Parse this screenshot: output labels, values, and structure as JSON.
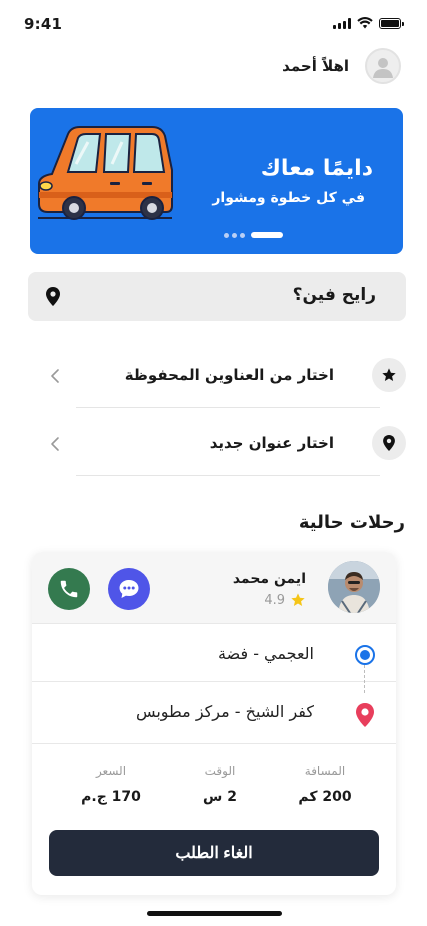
{
  "status_bar": {
    "time": "9:41"
  },
  "header": {
    "greeting": "اهلاً أحمد",
    "avatar_icon": "user-icon"
  },
  "banner": {
    "title": "دايمًا معاك",
    "subtitle": "في كل خطوة ومشوار",
    "background_color": "#1a73e8",
    "carousel": {
      "dot_count": 4,
      "active_index": 3
    }
  },
  "search": {
    "placeholder": "رايح فين؟",
    "icon": "location-pin-icon"
  },
  "address_options": [
    {
      "label": "اختار من العناوين المحفوظة",
      "icon": "star-icon"
    },
    {
      "label": "اختار عنوان جديد",
      "icon": "location-pin-icon"
    }
  ],
  "current_trips": {
    "title": "رحلات حالية",
    "trip": {
      "driver": {
        "name": "ايمن محمد",
        "rating": "4.9"
      },
      "actions": {
        "call_icon": "phone-icon",
        "chat_icon": "chat-icon"
      },
      "pickup": "العجمي - فضة",
      "dropoff": "كفر الشيخ - مركز مطوبس",
      "stats": [
        {
          "label": "المسافة",
          "value": "200 كم"
        },
        {
          "label": "الوقت",
          "value": "2 س"
        },
        {
          "label": "السعر",
          "value": "170 ج.م"
        }
      ],
      "cancel_label": "الغاء الطلب"
    }
  },
  "colors": {
    "primary_blue": "#1a73e8",
    "dark_button": "#232b3b",
    "call_green": "#347a4f",
    "chat_purple": "#4f55e8",
    "pickup_blue": "#1a73e8",
    "dropoff_red": "#e83e5c",
    "star_yellow": "#f5c518"
  }
}
